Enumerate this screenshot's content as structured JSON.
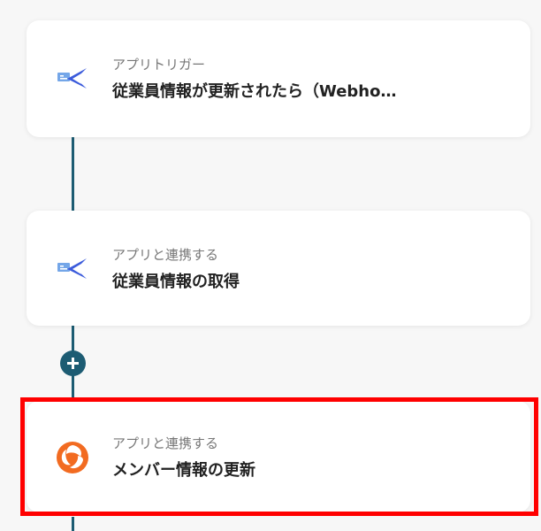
{
  "flow": {
    "steps": [
      {
        "subtitle": "アプリトリガー",
        "title": "従業員情報が更新されたら（Webho…",
        "icon": "hr-app-icon"
      },
      {
        "subtitle": "アプリと連携する",
        "title": "従業員情報の取得",
        "icon": "hr-app-icon"
      },
      {
        "subtitle": "アプリと連携する",
        "title": "メンバー情報の更新",
        "icon": "orange-app-icon",
        "selected": true
      }
    ],
    "add_button_icon": "plus-icon"
  },
  "colors": {
    "connector": "#1d5c73",
    "selected_border": "#ff0000",
    "hr_icon_blue": "#3b5bdb",
    "hr_icon_light": "#74a6e8",
    "orange_icon": "#f26b21"
  }
}
